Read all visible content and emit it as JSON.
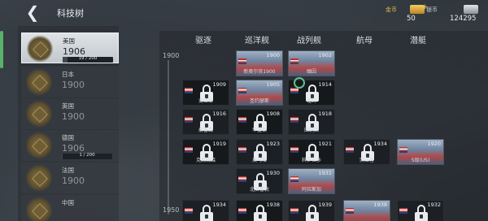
{
  "header": {
    "back_label": "❮",
    "title": "科技树"
  },
  "resources": {
    "gold": {
      "label": "金币",
      "value": "50",
      "plus": "+"
    },
    "silver": {
      "label": "银币",
      "value": "124295"
    }
  },
  "nations": [
    {
      "name": "美国",
      "year": "1906",
      "progress_text": "19 / 200",
      "progress": 0.095,
      "selected": true
    },
    {
      "name": "日本",
      "year": "1900"
    },
    {
      "name": "英国",
      "year": "1900"
    },
    {
      "name": "德国",
      "year": "1906",
      "progress_text": "1 / 200",
      "progress": 0.005
    },
    {
      "name": "法国",
      "year": "1900"
    },
    {
      "name": "中国",
      "year": ""
    }
  ],
  "columns": [
    "驱逐",
    "巡洋舰",
    "战列舰",
    "航母",
    "潜艇"
  ],
  "years": [
    "1900",
    "1950"
  ],
  "ships": [
    {
      "year": "1900",
      "name": "新奥尔良1900",
      "locked": false,
      "col": 1,
      "row": 0
    },
    {
      "year": "1902",
      "name": "缅因",
      "locked": false,
      "col": 2,
      "row": 0
    },
    {
      "year": "1909",
      "name": "史密斯",
      "locked": true,
      "col": 0,
      "row": 1
    },
    {
      "year": "1905",
      "name": "圣约瑟斯",
      "locked": false,
      "col": 1,
      "row": 1
    },
    {
      "year": "1914",
      "name": "纽约",
      "locked": true,
      "col": 2,
      "row": 1
    },
    {
      "year": "1916",
      "name": "桑普森",
      "locked": true,
      "col": 0,
      "row": 2
    },
    {
      "year": "1908",
      "name": "华盛顿",
      "locked": true,
      "col": 1,
      "row": 2
    },
    {
      "year": "1918",
      "name": "田纳西",
      "locked": true,
      "col": 2,
      "row": 2
    },
    {
      "year": "1919",
      "name": "克莱姆森",
      "locked": true,
      "col": 0,
      "row": 3
    },
    {
      "year": "1923",
      "name": "奥马哈",
      "locked": true,
      "col": 1,
      "row": 3
    },
    {
      "year": "1921",
      "name": "科罗拉多",
      "locked": true,
      "col": 2,
      "row": 3
    },
    {
      "year": "1934",
      "name": "突击者",
      "locked": true,
      "col": 3,
      "row": 3
    },
    {
      "year": "1920",
      "name": "S级(US)",
      "locked": false,
      "col": 4,
      "row": 3
    },
    {
      "year": "1930",
      "name": "北安普敦",
      "locked": true,
      "col": 1,
      "row": 4
    },
    {
      "year": "1931",
      "name": "阿拉斯加",
      "locked": false,
      "col": 2,
      "row": 4
    },
    {
      "year": "1934",
      "name": "",
      "locked": true,
      "col": 0,
      "row": 5
    },
    {
      "year": "1938",
      "name": "",
      "locked": true,
      "col": 1,
      "row": 5
    },
    {
      "year": "1939",
      "name": "",
      "locked": true,
      "col": 2,
      "row": 5
    },
    {
      "year": "1938",
      "name": "",
      "locked": false,
      "col": 3,
      "row": 5
    },
    {
      "year": "1932",
      "name": "",
      "locked": true,
      "col": 4,
      "row": 5
    }
  ]
}
